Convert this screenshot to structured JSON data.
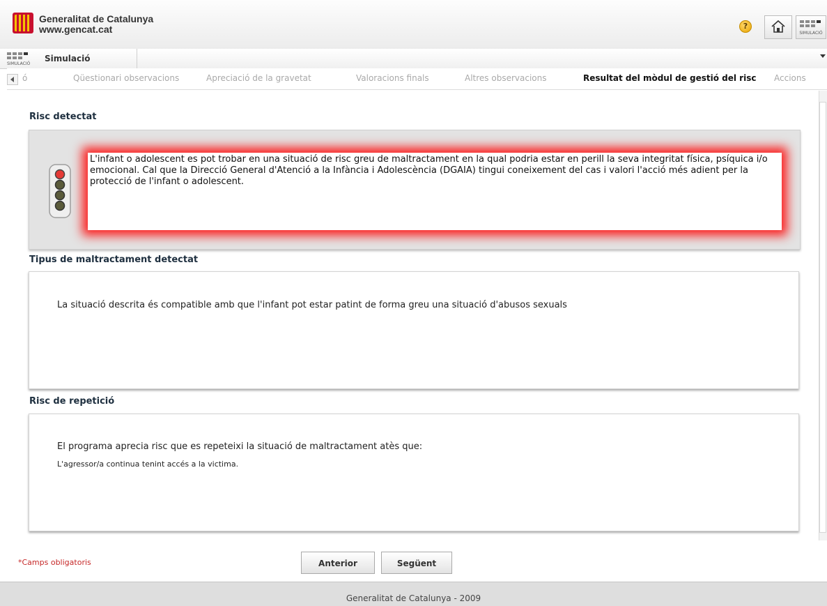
{
  "header": {
    "gov_name": "Generalitat de Catalunya",
    "gov_url": "www.gencat.cat",
    "help_symbol": "?",
    "help_icon": "help-circle-icon",
    "home_icon": "home-icon",
    "sim_logo_text": "SIMULACIÓ"
  },
  "module_bar": {
    "logo_text": "SIMULACIÓ",
    "title": "Simulació"
  },
  "steps": {
    "partial_label": "ó",
    "items": [
      {
        "label": "Qüestionari observacions"
      },
      {
        "label": "Apreciació de la gravetat"
      },
      {
        "label": "Valoracions finals"
      },
      {
        "label": "Altres observacions"
      },
      {
        "label": "Resultat del mòdul de gestió del risc"
      },
      {
        "label": "Accions"
      }
    ],
    "active": "Resultat del mòdul de gestió del risc"
  },
  "risk": {
    "title": "Risc detectat",
    "level": "red",
    "text": "L'infant o adolescent es pot trobar en una situació de risc greu de maltractament en la qual podria estar en perill la seva integritat física, psíquica i/o emocional. Cal que la Direcció General d'Atenció a la Infància i Adolescència (DGAIA) tingui coneixement del cas i valori l'acció més adient per la protecció de l'infant o adolescent.",
    "colors": {
      "glow": "#ff0000",
      "light_on": "#e53935",
      "light_off": "#5a5a3a"
    }
  },
  "maltreatment": {
    "title": "Tipus de maltractament detectat",
    "text": "La situació descrita és compatible amb que l'infant pot estar patint de forma greu una situació d'abusos sexuals"
  },
  "repetition": {
    "title": "Risc de repetició",
    "text": "El programa aprecia risc que es repeteixi la situació de maltractament atès que:",
    "reason": "L'agressor/a continua tenint accés a la victima."
  },
  "footer_actions": {
    "required_note": "*Camps obligatoris",
    "prev_label": "Anterior",
    "next_label": "Següent"
  },
  "footer": {
    "copyright": "Generalitat de Catalunya - 2009"
  }
}
